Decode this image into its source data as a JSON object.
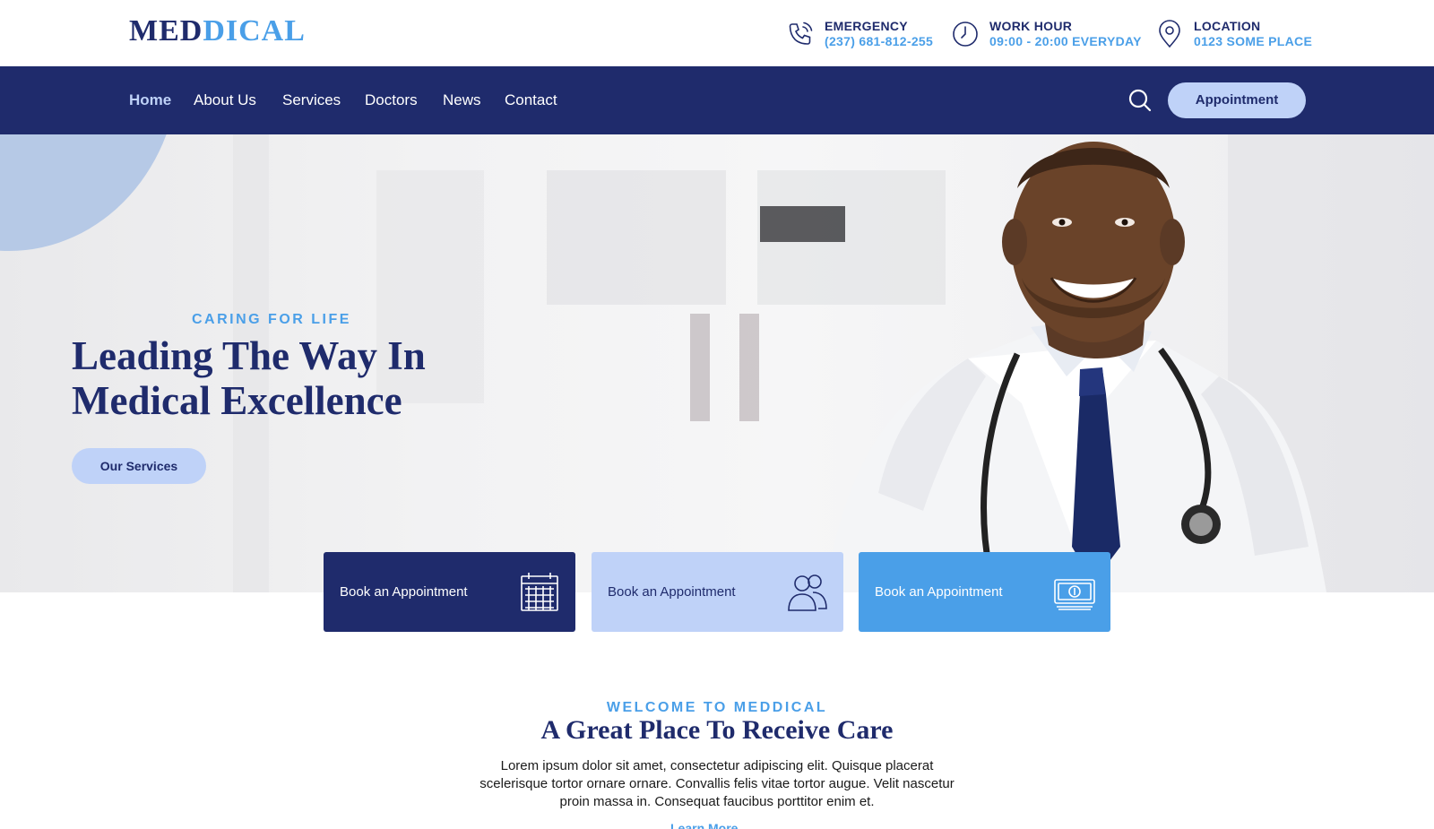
{
  "brand": {
    "logo_part1": "MED",
    "logo_part2": "DICAL"
  },
  "topbar": {
    "emergency": {
      "title": "EMERGENCY",
      "value": "(237) 681-812-255",
      "icon": "phone-icon"
    },
    "work_hour": {
      "title": "WORK HOUR",
      "value": "09:00 - 20:00 EVERYDAY",
      "icon": "clock-icon"
    },
    "location": {
      "title": "LOCATION",
      "value": "0123 SOME PLACE",
      "icon": "location-pin-icon"
    }
  },
  "nav": {
    "items": [
      {
        "label": "Home",
        "active": true
      },
      {
        "label": "About Us"
      },
      {
        "label": "Services"
      },
      {
        "label": "Doctors"
      },
      {
        "label": "News"
      },
      {
        "label": "Contact"
      }
    ],
    "search_icon": "search-icon",
    "cta": "Appointment"
  },
  "hero": {
    "eyebrow": "CARING FOR LIFE",
    "title": "Leading The Way In Medical Excellence",
    "button": "Our Services"
  },
  "cards": [
    {
      "label": "Book an Appointment",
      "icon": "calendar-icon"
    },
    {
      "label": "Book an Appointment",
      "icon": "people-icon"
    },
    {
      "label": "Book an Appointment",
      "icon": "money-icon"
    }
  ],
  "welcome": {
    "eyebrow": "WELCOME TO MEDDICAL",
    "title": "A Great Place To Receive Care",
    "body": "Lorem ipsum dolor sit amet, consectetur adipiscing elit. Quisque placerat scelerisque tortor ornare ornare. Convallis felis vitae tortor augue. Velit nascetur proin massa in. Consequat faucibus porttitor enim et.",
    "link": "Learn More"
  },
  "colors": {
    "navy": "#1f2b6c",
    "light_blue": "#bfd2f8",
    "accent_blue": "#4a9fe8"
  }
}
